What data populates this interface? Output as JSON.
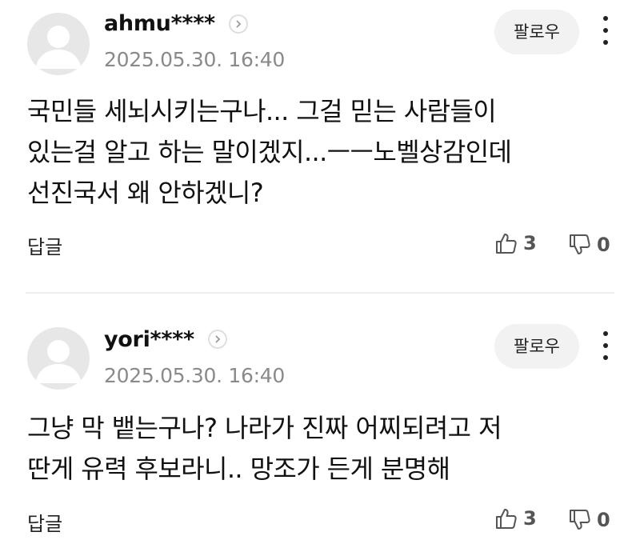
{
  "comments": [
    {
      "username": "ahmu****",
      "date": "2025.05.30. 16:40",
      "follow_label": "팔로우",
      "body_lines": [
        "국민들 세뇌시키는구나... 그걸 믿는 사람들이",
        "있는걸 알고 하는 말이겠지...ㅡㅡ노벨상감인데",
        "선진국서 왜 안하겠니?"
      ],
      "reply_label": "답글",
      "likes": "3",
      "dislikes": "0"
    },
    {
      "username": "yori****",
      "date": "2025.05.30. 16:40",
      "follow_label": "팔로우",
      "body_lines": [
        "그냥 막 뱉는구나? 나라가 진짜 어찌되려고 저",
        "딴게 유력 후보라니.. 망조가 든게 분명해"
      ],
      "reply_label": "답글",
      "likes": "3",
      "dislikes": "0"
    }
  ],
  "icons": {
    "avatar": "default-user-avatar",
    "profile_arrow": "chevron-right-icon",
    "more": "vertical-ellipsis-icon",
    "like": "thumbs-up-icon",
    "dislike": "thumbs-down-icon"
  },
  "colors": {
    "avatar_bg": "#e7e7e7",
    "date_text": "#8a8a8a",
    "follow_bg": "#f2f2f2",
    "divider": "#ededed"
  }
}
